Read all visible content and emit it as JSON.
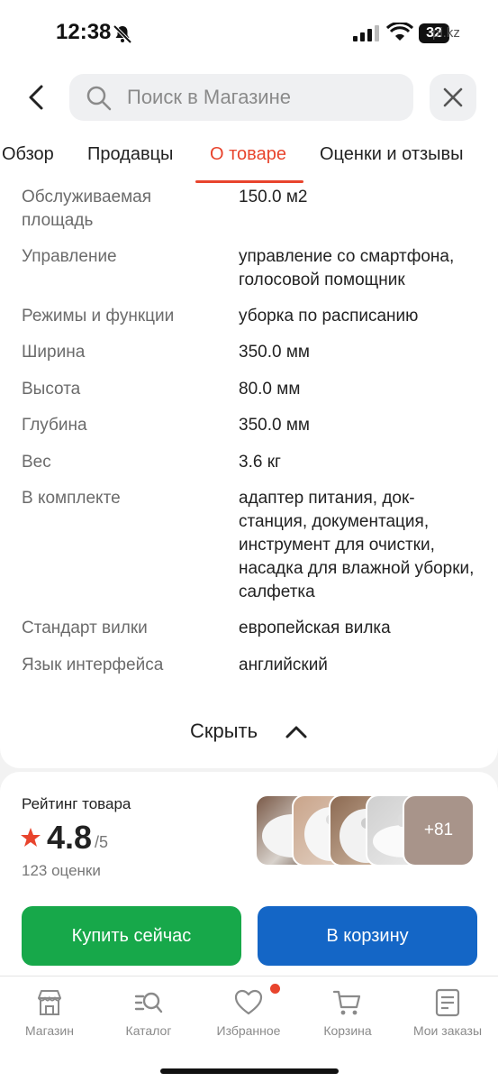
{
  "status_bar": {
    "time": "12:38",
    "battery": "32",
    "watermark": "pi.kz"
  },
  "search": {
    "placeholder": "Поиск в Магазине"
  },
  "tabs": [
    {
      "label": "Обзор",
      "active": false
    },
    {
      "label": "Продавцы",
      "active": false
    },
    {
      "label": "О товаре",
      "active": true
    },
    {
      "label": "Оценки и отзывы",
      "active": false
    }
  ],
  "specs": [
    {
      "label": "Обслуживаемая площадь",
      "value": "150.0 м2"
    },
    {
      "label": "Управление",
      "value": "управление со смартфона, голосовой помощник"
    },
    {
      "label": "Режимы и функции",
      "value": "уборка по расписанию"
    },
    {
      "label": "Ширина",
      "value": "350.0 мм"
    },
    {
      "label": "Высота",
      "value": "80.0 мм"
    },
    {
      "label": "Глубина",
      "value": "350.0 мм"
    },
    {
      "label": "Вес",
      "value": "3.6 кг"
    },
    {
      "label": "В комплекте",
      "value": "адаптер питания, док-станция, документация, инструмент для очистки, насадка для влажной уборки, салфетка"
    },
    {
      "label": "Стандарт вилки",
      "value": "европейская вилка"
    },
    {
      "label": "Язык интерфейса",
      "value": "английский"
    }
  ],
  "hide_label": "Скрыть",
  "rating": {
    "title": "Рейтинг товара",
    "value": "4.8",
    "max": "/5",
    "count": "123 оценки",
    "more_photos": "+81",
    "star_color": "#e8442d"
  },
  "actions": {
    "buy": "Купить сейчас",
    "cart": "В корзину"
  },
  "nav": [
    {
      "label": "Магазин",
      "icon": "store-icon"
    },
    {
      "label": "Каталог",
      "icon": "catalog-search-icon"
    },
    {
      "label": "Избранное",
      "icon": "heart-icon",
      "has_dot": true
    },
    {
      "label": "Корзина",
      "icon": "cart-icon"
    },
    {
      "label": "Мои заказы",
      "icon": "orders-icon"
    }
  ],
  "colors": {
    "accent": "#e8442d",
    "buy": "#17a84a",
    "cart": "#1466c6"
  }
}
